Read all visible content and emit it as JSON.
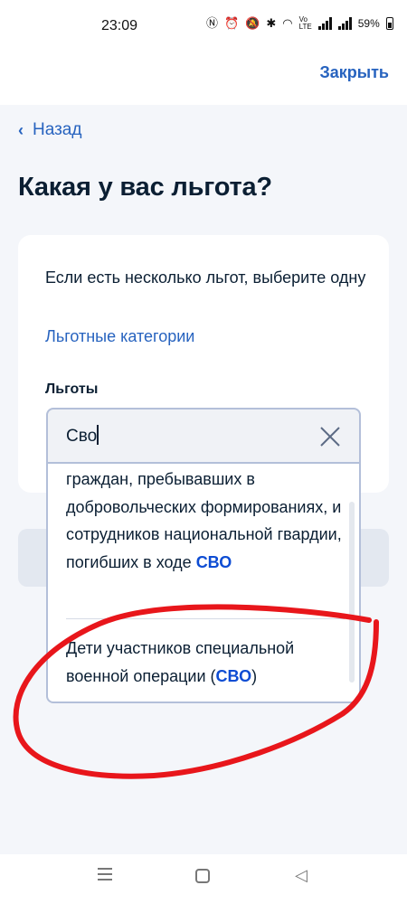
{
  "status_bar": {
    "time": "23:09",
    "battery": "59%",
    "icons": [
      "nfc-icon",
      "alarm-icon",
      "mute-icon",
      "bluetooth-icon",
      "wifi-icon",
      "volte-icon",
      "signal-icon",
      "signal-icon",
      "battery-icon"
    ]
  },
  "header": {
    "close_label": "Закрыть"
  },
  "nav": {
    "back_label": "Назад"
  },
  "page": {
    "title": "Какая у вас льгота?"
  },
  "card": {
    "hint": "Если есть несколько льгот, выберите одну",
    "link": "Льготные категории",
    "field_label": "Льготы"
  },
  "search": {
    "value": "Сво"
  },
  "dropdown": {
    "option_1": {
      "text": "граждан, пребывавших в добровольческих формированиях, и сотрудников национальной гвардии, погибших в ходе ",
      "highlight": "СВО"
    },
    "option_2": {
      "text_before": "Дети участников специальной военной операции (",
      "highlight": "СВО",
      "text_after": ")"
    }
  },
  "colors": {
    "accent": "#2763bf",
    "highlight": "#0d4cd3",
    "background": "#f4f6fa",
    "annotation": "#e8161b"
  }
}
